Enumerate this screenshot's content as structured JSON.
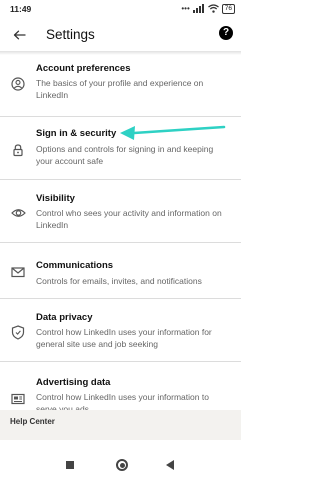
{
  "status_bar": {
    "time": "11:49",
    "battery": "76"
  },
  "header": {
    "title": "Settings",
    "help_symbol": "?"
  },
  "items": [
    {
      "title": "Account preferences",
      "description": "The basics of your profile and experience on LinkedIn",
      "icon": "person-circle-icon"
    },
    {
      "title": "Sign in & security",
      "description": "Options and controls for signing in and keeping your account safe",
      "icon": "lock-icon"
    },
    {
      "title": "Visibility",
      "description": "Control who sees your activity and information on LinkedIn",
      "icon": "eye-icon"
    },
    {
      "title": "Communications",
      "description": "Controls for emails, invites, and notifications",
      "icon": "envelope-icon"
    },
    {
      "title": "Data privacy",
      "description": "Control how LinkedIn uses your information for general site use and job seeking",
      "icon": "shield-icon"
    },
    {
      "title": "Advertising data",
      "description": "Control how LinkedIn uses your information to serve you ads",
      "icon": "newspaper-icon"
    }
  ],
  "section": {
    "label": "Help Center"
  },
  "annotation": {
    "color": "#2ed1c4"
  }
}
